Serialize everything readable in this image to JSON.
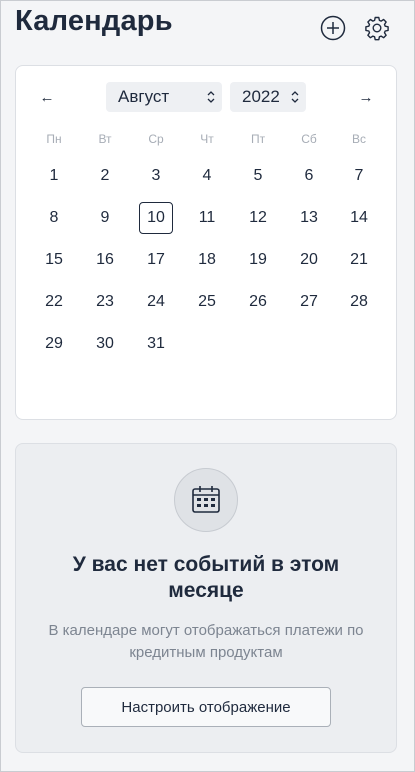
{
  "header": {
    "title": "Календарь",
    "add_icon": "plus-circle-icon",
    "settings_icon": "gear-icon"
  },
  "calendar": {
    "prev_arrow": "←",
    "next_arrow": "→",
    "month": "Август",
    "year": "2022",
    "weekdays": [
      "Пн",
      "Вт",
      "Ср",
      "Чт",
      "Пт",
      "Сб",
      "Вс"
    ],
    "weeks": [
      [
        "1",
        "2",
        "3",
        "4",
        "5",
        "6",
        "7"
      ],
      [
        "8",
        "9",
        "10",
        "11",
        "12",
        "13",
        "14"
      ],
      [
        "15",
        "16",
        "17",
        "18",
        "19",
        "20",
        "21"
      ],
      [
        "22",
        "23",
        "24",
        "25",
        "26",
        "27",
        "28"
      ],
      [
        "29",
        "30",
        "31",
        "",
        "",
        "",
        ""
      ]
    ],
    "selected_day": "10"
  },
  "empty_state": {
    "icon": "calendar-icon",
    "title": "У вас нет событий в этом месяце",
    "description": "В календаре могут отображаться платежи по кредитным продуктам",
    "button_label": "Настроить отображение"
  },
  "colors": {
    "text_primary": "#1f2a3d",
    "text_muted": "#7d8591",
    "background": "#f4f5f7"
  }
}
